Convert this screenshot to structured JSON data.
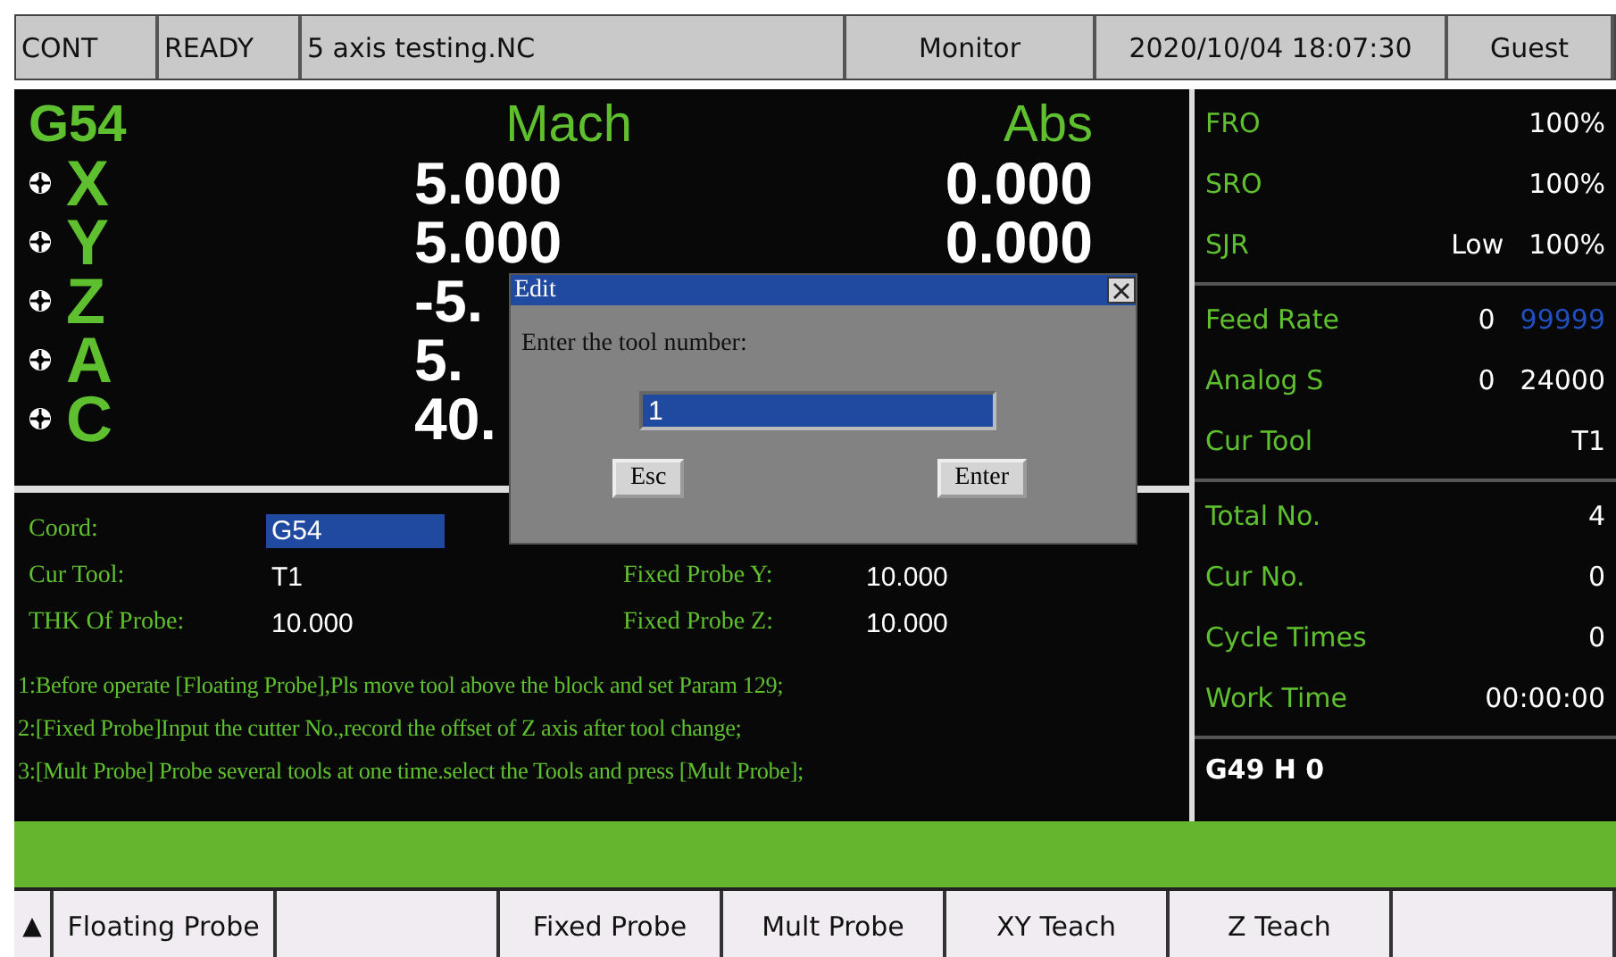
{
  "status_bar": [
    "CONT",
    "READY",
    "5 axis testing.NC",
    "Monitor",
    "2020/10/04 18:07:30",
    "Guest"
  ],
  "position": {
    "coord": "G54",
    "mach_header": "Mach",
    "abs_header": "Abs",
    "axes": [
      {
        "name": "X",
        "mach": "5.000",
        "abs": "0.000"
      },
      {
        "name": "Y",
        "mach": "5.000",
        "abs": "0.000"
      },
      {
        "name": "Z",
        "mach": "-5."
      },
      {
        "name": "A",
        "mach": "5."
      },
      {
        "name": "C",
        "mach": "40."
      }
    ]
  },
  "params": {
    "left": [
      {
        "label": "Coord:",
        "value": "G54",
        "selected": true
      },
      {
        "label": "Cur Tool:",
        "value": "T1",
        "selected": false
      },
      {
        "label": "THK Of Probe:",
        "value": "10.000",
        "selected": false
      }
    ],
    "right": [
      {
        "label": "Fixed Probe Y:",
        "value": "10.000"
      },
      {
        "label": "Fixed Probe Z:",
        "value": "10.000"
      }
    ]
  },
  "notes": [
    "1:Before operate [Floating Probe],Pls move tool above the block and set Param 129;",
    "2:[Fixed Probe]Input the cutter No.,record the offset of Z axis after tool change;",
    "3:[Mult Probe] Probe several tools at one time.select the Tools and press [Mult Probe];"
  ],
  "side_panel": [
    [
      {
        "label": "FRO",
        "values": [
          {
            "text": "100%",
            "kind": "normal"
          }
        ]
      },
      {
        "label": "SRO",
        "values": [
          {
            "text": "100%",
            "kind": "normal"
          }
        ]
      },
      {
        "label": "SJR",
        "values": [
          {
            "text": "Low",
            "kind": "normal"
          },
          {
            "text": "100%",
            "kind": "normal"
          }
        ]
      }
    ],
    [
      {
        "label": "Feed Rate",
        "values": [
          {
            "text": "0",
            "kind": "normal"
          },
          {
            "text": "99999",
            "kind": "limit"
          }
        ]
      },
      {
        "label": "Analog S",
        "values": [
          {
            "text": "0",
            "kind": "normal"
          },
          {
            "text": "24000",
            "kind": "normal"
          }
        ]
      },
      {
        "label": "Cur Tool",
        "values": [
          {
            "text": "T1",
            "kind": "normal"
          }
        ]
      }
    ],
    [
      {
        "label": "Total No.",
        "values": [
          {
            "text": "4",
            "kind": "normal"
          }
        ]
      },
      {
        "label": "Cur No.",
        "values": [
          {
            "text": "0",
            "kind": "normal"
          }
        ]
      },
      {
        "label": "Cycle Times",
        "values": [
          {
            "text": "0",
            "kind": "normal"
          }
        ]
      },
      {
        "label": "Work Time",
        "values": [
          {
            "text": "00:00:00",
            "kind": "normal"
          }
        ]
      }
    ]
  ],
  "side_code": "G49 H 0",
  "dialog": {
    "title": "Edit",
    "prompt": "Enter the tool number:",
    "value": "1",
    "buttons": [
      "Esc",
      "Enter"
    ]
  },
  "softkeys": [
    {
      "label": "▲",
      "kind": "arrow"
    },
    {
      "label": "Floating Probe",
      "kind": "key"
    },
    {
      "kind": "key"
    },
    {
      "label": "Fixed Probe",
      "kind": "key"
    },
    {
      "label": "Mult Probe",
      "kind": "key"
    },
    {
      "label": "XY Teach",
      "kind": "key"
    },
    {
      "label": "Z Teach",
      "kind": "key"
    },
    {
      "kind": "key"
    }
  ]
}
